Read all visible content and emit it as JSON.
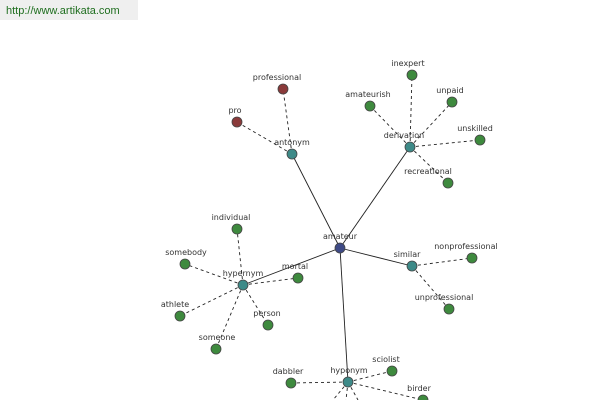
{
  "source_url": "http://www.artikata.com",
  "colors": {
    "center": "#3e4a86",
    "relation": "#3d8a88",
    "word": "#3e8a3e",
    "antonym_word": "#8a3a3a",
    "node_stroke": "#444444",
    "edge": "#222222"
  },
  "center": {
    "id": "center",
    "label": "amateur",
    "kind": "center"
  },
  "relations": [
    {
      "id": "antonym",
      "label": "antonym",
      "words": [
        {
          "id": "pro",
          "label": "pro",
          "kind": "antonym_word"
        },
        {
          "id": "professional",
          "label": "professional",
          "kind": "antonym_word"
        }
      ]
    },
    {
      "id": "derivation",
      "label": "derivation",
      "words": [
        {
          "id": "amateurish",
          "label": "amateurish",
          "kind": "word"
        },
        {
          "id": "inexpert",
          "label": "inexpert",
          "kind": "word"
        },
        {
          "id": "unpaid",
          "label": "unpaid",
          "kind": "word"
        },
        {
          "id": "unskilled",
          "label": "unskilled",
          "kind": "word"
        },
        {
          "id": "recreational",
          "label": "recreational",
          "kind": "word"
        }
      ]
    },
    {
      "id": "similar",
      "label": "similar",
      "words": [
        {
          "id": "nonprofessional",
          "label": "nonprofessional",
          "kind": "word"
        },
        {
          "id": "unprofessional",
          "label": "unprofessional",
          "kind": "word"
        }
      ]
    },
    {
      "id": "hypernym",
      "label": "hypernym",
      "words": [
        {
          "id": "individual",
          "label": "individual",
          "kind": "word"
        },
        {
          "id": "somebody",
          "label": "somebody",
          "kind": "word"
        },
        {
          "id": "mortal",
          "label": "mortal",
          "kind": "word"
        },
        {
          "id": "athlete",
          "label": "athlete",
          "kind": "word"
        },
        {
          "id": "person",
          "label": "person",
          "kind": "word"
        },
        {
          "id": "someone",
          "label": "someone",
          "kind": "word"
        }
      ]
    },
    {
      "id": "hyponym",
      "label": "hyponym",
      "words": [
        {
          "id": "dabbler",
          "label": "dabbler",
          "kind": "word"
        },
        {
          "id": "sciolist",
          "label": "sciolist",
          "kind": "word"
        },
        {
          "id": "birder",
          "label": "birder",
          "kind": "word"
        }
      ]
    }
  ]
}
